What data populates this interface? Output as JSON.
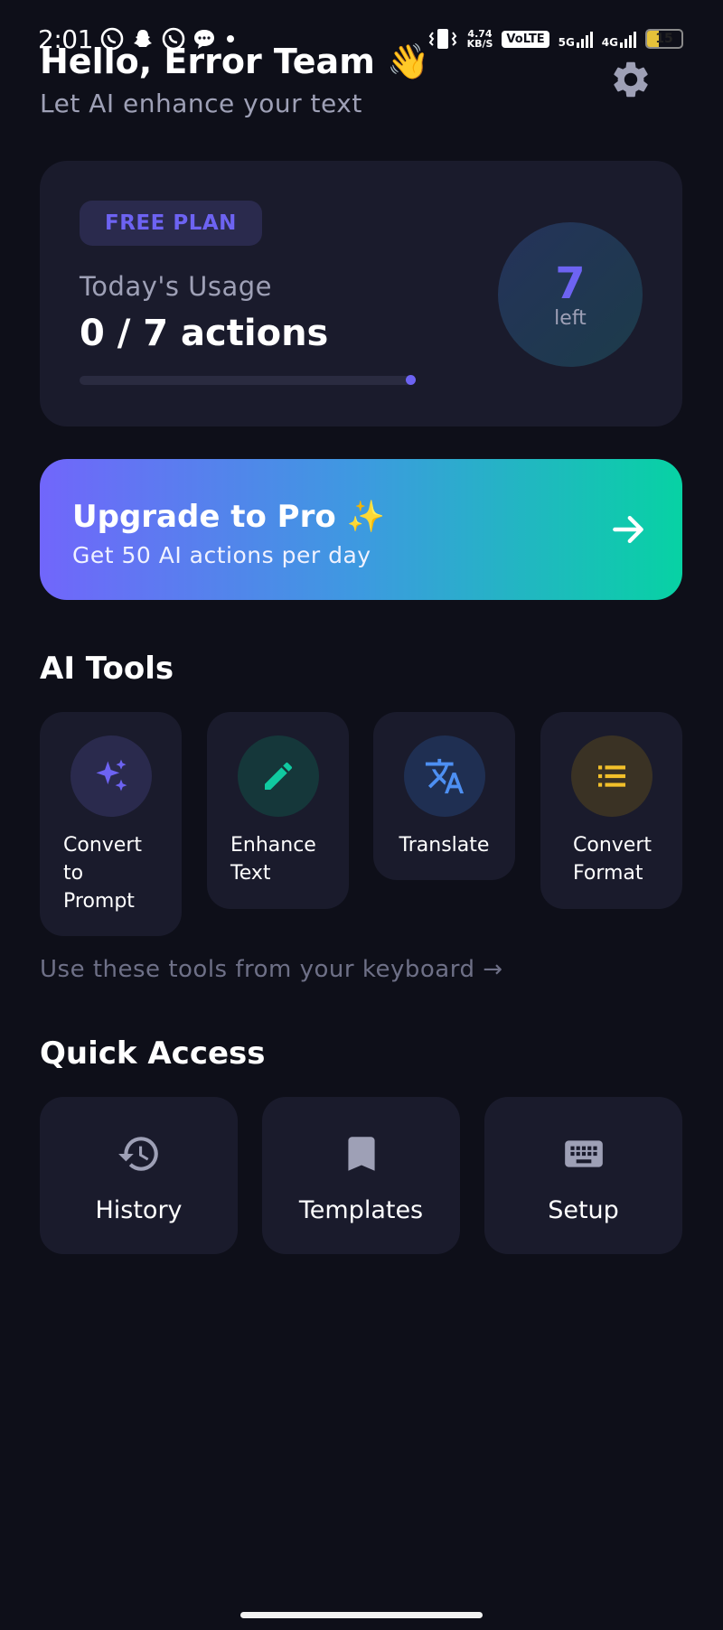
{
  "status_bar": {
    "time": "2:01",
    "speed_value": "4.74",
    "speed_unit": "KB/S",
    "volte": "VoLTE",
    "net1": "5G",
    "net2": "4G",
    "battery": "15",
    "icons": [
      "whatsapp-icon",
      "snapchat-icon",
      "whatsapp-icon",
      "message-icon"
    ]
  },
  "header": {
    "greeting": "Hello, Error Team 👋",
    "subtitle": "Let AI enhance your text"
  },
  "usage": {
    "plan": "FREE PLAN",
    "label": "Today's Usage",
    "value": "0 / 7 actions",
    "progress_fraction": 0,
    "left_count": "7",
    "left_label": "left"
  },
  "upgrade": {
    "title": "Upgrade to Pro ✨",
    "subtitle": "Get 50 AI actions per day"
  },
  "ai_tools": {
    "title": "AI Tools",
    "items": [
      {
        "label": "Convert to Prompt",
        "icon": "sparkles-icon",
        "color": "#6d63f2"
      },
      {
        "label": "Enhance Text",
        "icon": "pencil-icon",
        "color": "#10c9a0"
      },
      {
        "label": "Translate",
        "icon": "translate-icon",
        "color": "#4d8ff2"
      },
      {
        "label": "Convert Format",
        "icon": "list-icon",
        "color": "#f2c02a"
      }
    ],
    "hint": "Use these tools from your keyboard →"
  },
  "quick_access": {
    "title": "Quick Access",
    "items": [
      {
        "label": "History",
        "icon": "history-icon"
      },
      {
        "label": "Templates",
        "icon": "bookmark-icon"
      },
      {
        "label": "Setup",
        "icon": "keyboard-icon"
      }
    ]
  },
  "colors": {
    "background": "#0e0f19",
    "card": "#1a1b2c",
    "accent": "#6d63f2",
    "gradient_start": "#7166fb",
    "gradient_end": "#07d2a4"
  }
}
